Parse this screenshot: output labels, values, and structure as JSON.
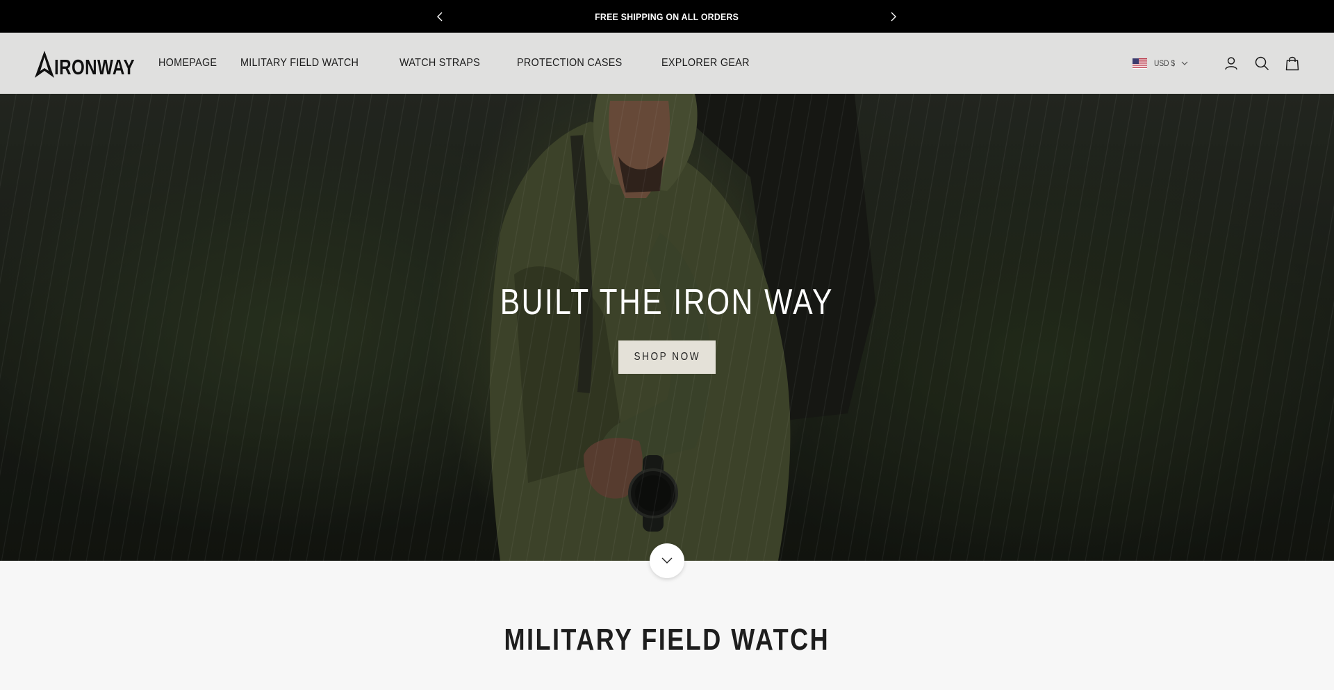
{
  "announcement": {
    "text": "FREE SHIPPING ON ALL ORDERS"
  },
  "brand": {
    "name": "IRONWAY"
  },
  "nav": {
    "items": [
      {
        "label": "HOMEPAGE"
      },
      {
        "label": "MILITARY FIELD WATCH"
      },
      {
        "label": "WATCH STRAPS"
      },
      {
        "label": "PROTECTION CASES"
      },
      {
        "label": "EXPLORER GEAR"
      }
    ]
  },
  "header": {
    "currency": "USD $",
    "icons": [
      "account-icon",
      "search-icon",
      "cart-icon"
    ]
  },
  "hero": {
    "title": "BUILT THE IRON WAY",
    "cta": "SHOP NOW"
  },
  "section": {
    "title": "MILITARY FIELD WATCH"
  },
  "colors": {
    "announce_bg": "#000000",
    "header_bg": "#e0e0df",
    "cta_bg": "#e4e1d8",
    "page_bg": "#f7f7f7"
  }
}
